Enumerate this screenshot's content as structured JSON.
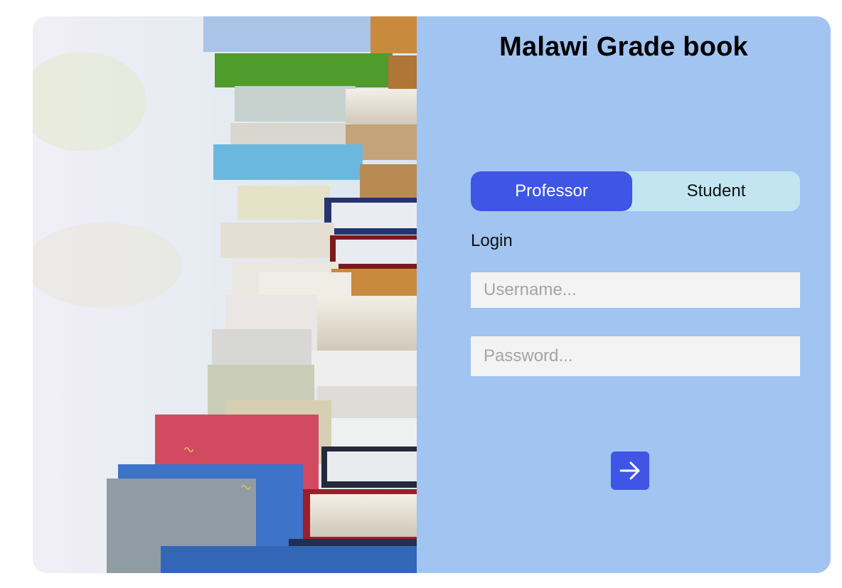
{
  "app": {
    "title": "Malawi Grade book"
  },
  "role_toggle": {
    "options": [
      {
        "label": "Professor",
        "active": true
      },
      {
        "label": "Student",
        "active": false
      }
    ]
  },
  "login": {
    "label": "Login",
    "username_placeholder": "Username...",
    "password_placeholder": "Password...",
    "submit_icon": "arrow-right-icon"
  },
  "hero_image": {
    "icon": "stacked-books-photo"
  },
  "colors": {
    "panel_bg": "#a1c4f1",
    "accent": "#3e55e6",
    "toggle_bg": "#c2e5f1",
    "input_bg": "#f3f3f4"
  }
}
